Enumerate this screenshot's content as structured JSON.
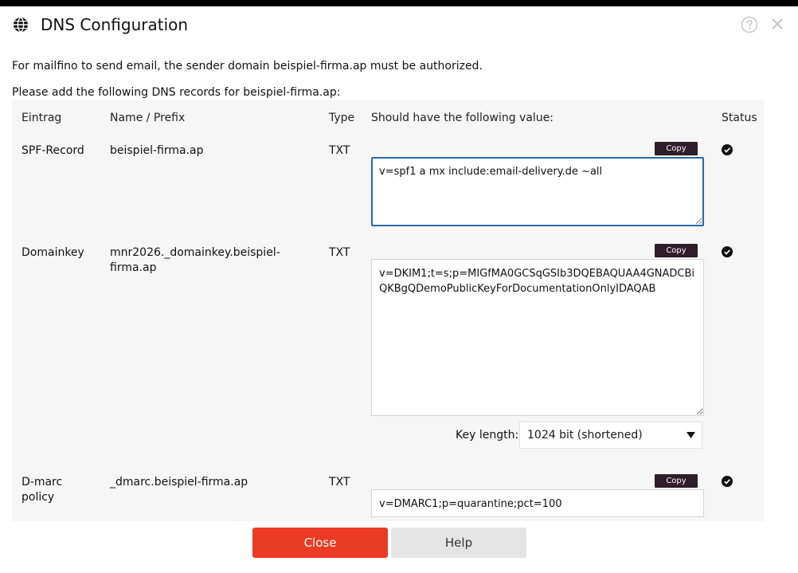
{
  "dialog": {
    "title": "DNS Configuration",
    "intro_line1": "For mailfino to send email, the sender domain beispiel-firma.ap must be authorized.",
    "intro_line2": "Please add the following DNS records for beispiel-firma.ap:"
  },
  "table": {
    "headers": {
      "entry": "Eintrag",
      "name": "Name / Prefix",
      "type": "Type",
      "value": "Should have the following value:",
      "status": "Status"
    },
    "copy_label": "Copy",
    "rows": [
      {
        "entry": "SPF-Record",
        "name": "beispiel-firma.ap",
        "type": "TXT",
        "value": "v=spf1 a mx include:email-delivery.de ~all",
        "status_icon": "check-circle-icon"
      },
      {
        "entry": "Domainkey",
        "name": "mnr2026._domainkey.beispiel-firma.ap",
        "type": "TXT",
        "value": "v=DKIM1;t=s;p=MIGfMA0GCSqGSIb3DQEBAQUAA4GNADCBiQKBgQDemoPublicKeyForDocumentationOnlyIDAQAB",
        "status_icon": "check-circle-icon"
      },
      {
        "entry": "D-marc policy",
        "name": "_dmarc.beispiel-firma.ap",
        "type": "TXT",
        "value": "v=DMARC1;p=quarantine;pct=100",
        "status_icon": "check-circle-icon"
      }
    ],
    "key_length": {
      "label": "Key length:",
      "selected": "1024 bit (shortened)"
    }
  },
  "footer": {
    "close_label": "Close",
    "help_label": "Help"
  },
  "colors": {
    "primary_button": "#ec3b24",
    "secondary_button": "#e4e4e4",
    "copy_button": "#2d1e2a",
    "focus_border": "#2c68a6",
    "panel_bg": "#f6f6f6"
  }
}
